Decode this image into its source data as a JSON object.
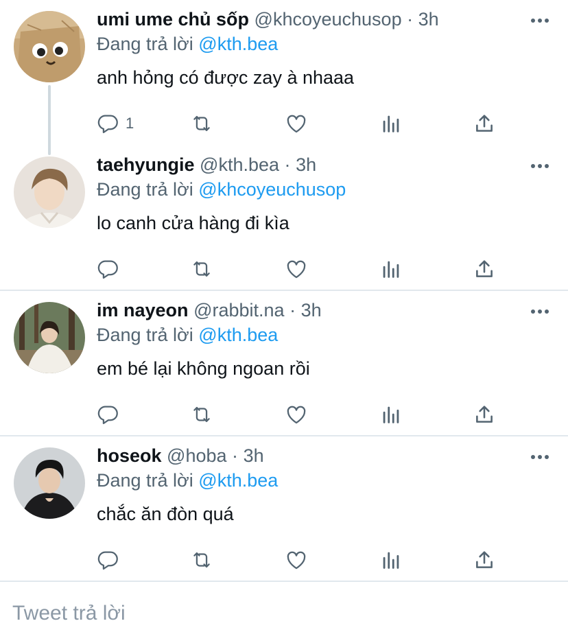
{
  "reply_prefix": "Đang trả lời",
  "tweets": [
    {
      "name": "umi ume chủ sốp",
      "handle": "@khcoyeuchusop",
      "dot": "·",
      "time": "3h",
      "replying_to": "@kth.bea",
      "text": "anh hỏng có được zay à nhaaa",
      "reply_count": "1",
      "avatar": "avatar-paper-bag"
    },
    {
      "name": "taehyungie",
      "handle": "@kth.bea",
      "dot": "·",
      "time": "3h",
      "replying_to": "@khcoyeuchusop",
      "text": "lo canh cửa hàng đi kìa",
      "reply_count": "",
      "avatar": "avatar-person-light"
    },
    {
      "name": "im nayeon",
      "handle": "@rabbit.na",
      "dot": "·",
      "time": "3h",
      "replying_to": "@kth.bea",
      "text": "em bé lại không ngoan rồi",
      "reply_count": "",
      "avatar": "avatar-person-forest"
    },
    {
      "name": "hoseok",
      "handle": "@hoba",
      "dot": "·",
      "time": "3h",
      "replying_to": "@kth.bea",
      "text": "chắc ăn đòn quá",
      "reply_count": "",
      "avatar": "avatar-person-dark"
    }
  ],
  "reply_placeholder": "Tweet trả lời",
  "colors": {
    "accent": "#1d9bf0",
    "secondary_text": "#536471",
    "icon": "#536471",
    "divider": "#e1e8ed",
    "thread_line": "#cfd9de"
  },
  "icons": [
    "reply-icon",
    "retweet-icon",
    "like-icon",
    "analytics-icon",
    "share-icon",
    "more-icon"
  ]
}
